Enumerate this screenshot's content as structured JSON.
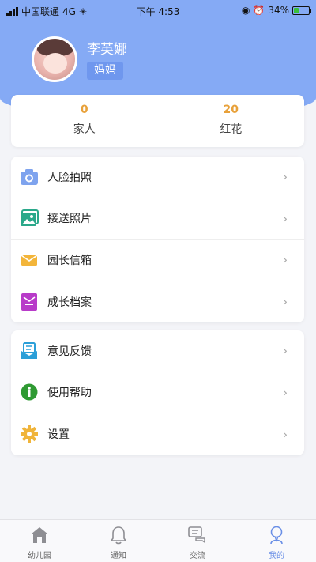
{
  "status_bar": {
    "carrier": "中国联通",
    "network": "4G",
    "time": "下午 4:53",
    "battery": "34%",
    "battery_level": 0.34
  },
  "profile": {
    "name": "李英娜",
    "role": "妈妈"
  },
  "stats": [
    {
      "value": "0",
      "label": "家人"
    },
    {
      "value": "20",
      "label": "红花"
    }
  ],
  "menu_group_1": [
    {
      "label": "人脸拍照",
      "icon": "camera-icon"
    },
    {
      "label": "接送照片",
      "icon": "photo-icon"
    },
    {
      "label": "园长信箱",
      "icon": "mail-icon"
    },
    {
      "label": "成长档案",
      "icon": "archive-icon"
    }
  ],
  "menu_group_2": [
    {
      "label": "意见反馈",
      "icon": "feedback-icon"
    },
    {
      "label": "使用帮助",
      "icon": "info-icon"
    },
    {
      "label": "设置",
      "icon": "gear-icon"
    }
  ],
  "tabbar": {
    "items": [
      {
        "label": "幼儿园",
        "icon": "home-icon"
      },
      {
        "label": "通知",
        "icon": "bell-icon"
      },
      {
        "label": "交流",
        "icon": "chat-icon"
      },
      {
        "label": "我的",
        "icon": "user-icon",
        "active": true
      }
    ]
  },
  "colors": {
    "header": "#85aaf5",
    "accent_number": "#e8a13a",
    "active_tab": "#6a8fe6"
  }
}
